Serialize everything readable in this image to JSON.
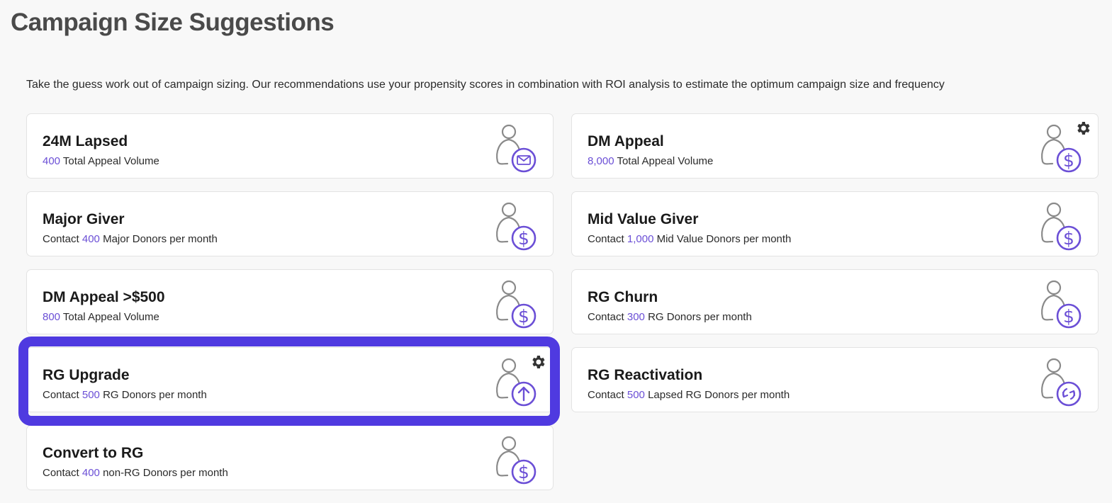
{
  "page": {
    "title": "Campaign Size Suggestions",
    "intro": "Take the guess work out of campaign sizing. Our recommendations use your propensity scores in combination with ROI analysis to estimate the optimum campaign size and frequency"
  },
  "colors": {
    "accent": "#6b4fd6",
    "highlight_border": "#4f3ae0",
    "person_outline": "#8a8a8a"
  },
  "cards": [
    {
      "title": "24M Lapsed",
      "prefix": "",
      "number": "400",
      "suffix": " Total Appeal Volume",
      "icon": "person-mail-icon",
      "has_gear": false
    },
    {
      "title": "DM Appeal",
      "prefix": "",
      "number": "8,000",
      "suffix": " Total Appeal Volume",
      "icon": "person-dollar-icon",
      "has_gear": true
    },
    {
      "title": "Major Giver",
      "prefix": "Contact ",
      "number": "400",
      "suffix": " Major Donors per month",
      "icon": "person-dollar-icon",
      "has_gear": false
    },
    {
      "title": "Mid Value Giver",
      "prefix": "Contact ",
      "number": "1,000",
      "suffix": " Mid Value Donors per month",
      "icon": "person-dollar-icon",
      "has_gear": false
    },
    {
      "title": "DM Appeal >$500",
      "prefix": "",
      "number": "800",
      "suffix": " Total Appeal Volume",
      "icon": "person-dollar-icon",
      "has_gear": false
    },
    {
      "title": "RG Churn",
      "prefix": "Contact ",
      "number": "300",
      "suffix": " RG Donors per month",
      "icon": "person-dollar-icon",
      "has_gear": false
    },
    {
      "title": "RG Upgrade",
      "prefix": "Contact ",
      "number": "500",
      "suffix": " RG Donors per month",
      "icon": "person-upgrade-icon",
      "has_gear": true,
      "highlighted": true
    },
    {
      "title": "RG Reactivation",
      "prefix": "Contact ",
      "number": "500",
      "suffix": " Lapsed RG Donors per month",
      "icon": "person-refresh-icon",
      "has_gear": false
    },
    {
      "title": "Convert to RG",
      "prefix": "Contact ",
      "number": "400",
      "suffix": " non-RG Donors per month",
      "icon": "person-dollar-icon",
      "has_gear": false
    }
  ]
}
